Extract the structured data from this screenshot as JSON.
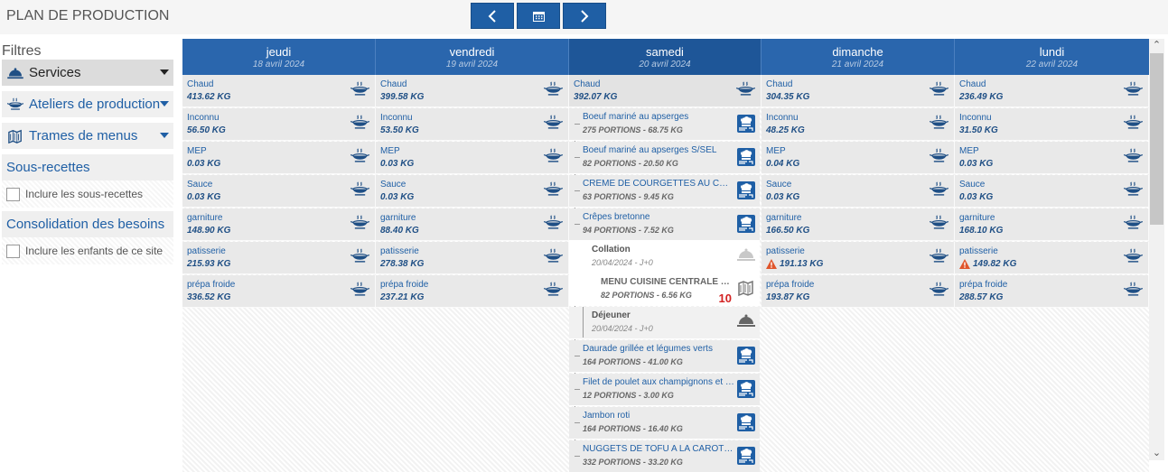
{
  "app": {
    "title": "PLAN DE PRODUCTION"
  },
  "nav": {
    "prev_icon": "chevron-left-icon",
    "calendar_icon": "calendar-icon",
    "next_icon": "chevron-right-icon"
  },
  "sidebar": {
    "title": "Filtres",
    "filters": [
      {
        "label": "Services",
        "icon": "bell-icon"
      },
      {
        "label": "Ateliers de production",
        "icon": "pot-icon"
      },
      {
        "label": "Trames de menus",
        "icon": "menu-grid-icon"
      }
    ],
    "subrecipes": {
      "title": "Sous-recettes",
      "checkbox_label": "Inclure les sous-recettes",
      "checked": false
    },
    "consolidation": {
      "title": "Consolidation des besoins",
      "checkbox_label": "Inclure les enfants de ce site",
      "checked": false
    }
  },
  "colors": {
    "header": "#2a66ad",
    "header_selected": "#1e5698",
    "link": "#1f5fa5",
    "warning": "#e0552b",
    "count": "#d32222"
  },
  "days": [
    {
      "name": "jeudi",
      "date": "18 avril 2024",
      "rows": [
        {
          "name": "Chaud",
          "value": "413.62 KG"
        },
        {
          "name": "Inconnu",
          "value": "56.50 KG"
        },
        {
          "name": "MEP",
          "value": "0.03 KG"
        },
        {
          "name": "Sauce",
          "value": "0.03 KG"
        },
        {
          "name": "garniture",
          "value": "148.90 KG"
        },
        {
          "name": "patisserie",
          "value": "215.93 KG"
        },
        {
          "name": "prépa froide",
          "value": "336.52 KG"
        }
      ]
    },
    {
      "name": "vendredi",
      "date": "19 avril 2024",
      "rows": [
        {
          "name": "Chaud",
          "value": "399.58 KG"
        },
        {
          "name": "Inconnu",
          "value": "53.50 KG"
        },
        {
          "name": "MEP",
          "value": "0.03 KG"
        },
        {
          "name": "Sauce",
          "value": "0.03 KG"
        },
        {
          "name": "garniture",
          "value": "88.40 KG"
        },
        {
          "name": "patisserie",
          "value": "278.38 KG"
        },
        {
          "name": "prépa froide",
          "value": "237.21 KG"
        }
      ]
    },
    {
      "name": "samedi",
      "date": "20 avril 2024",
      "rows": [
        {
          "name": "Chaud",
          "value": "392.07 KG"
        }
      ]
    },
    {
      "name": "dimanche",
      "date": "21 avril 2024",
      "rows": [
        {
          "name": "Chaud",
          "value": "304.35 KG"
        },
        {
          "name": "Inconnu",
          "value": "48.25 KG"
        },
        {
          "name": "MEP",
          "value": "0.04 KG"
        },
        {
          "name": "Sauce",
          "value": "0.03 KG"
        },
        {
          "name": "garniture",
          "value": "166.50 KG"
        },
        {
          "name": "patisserie",
          "value": "191.13 KG",
          "warning": true
        },
        {
          "name": "prépa froide",
          "value": "193.87 KG"
        }
      ]
    },
    {
      "name": "lundi",
      "date": "22 avril 2024",
      "rows": [
        {
          "name": "Chaud",
          "value": "236.49 KG"
        },
        {
          "name": "Inconnu",
          "value": "31.50 KG"
        },
        {
          "name": "MEP",
          "value": "0.03 KG"
        },
        {
          "name": "Sauce",
          "value": "0.03 KG"
        },
        {
          "name": "garniture",
          "value": "168.10 KG"
        },
        {
          "name": "patisserie",
          "value": "149.82 KG",
          "warning": true
        },
        {
          "name": "prépa froide",
          "value": "288.57 KG"
        }
      ]
    }
  ],
  "samedi_items": [
    {
      "name": "Boeuf mariné au apserges",
      "sub": "275 PORTIONS - 68.75 KG"
    },
    {
      "name": "Boeuf mariné au apserges S/SEL",
      "sub": "82 PORTIONS - 20.50 KG"
    },
    {
      "name": "CREME DE COURGETTES AU CHEVRE",
      "sub": "63 PORTIONS - 9.45 KG"
    },
    {
      "name": "Crêpes bretonne",
      "sub": "94 PORTIONS - 7.52 KG"
    }
  ],
  "collation": {
    "name": "Collation",
    "date": "20/04/2024 - J+0"
  },
  "menu": {
    "name": "MENU CUISINE CENTRALE MIDI",
    "sub": "82 PORTIONS - 6.56 KG",
    "count": "10"
  },
  "dejeuner": {
    "name": "Déjeuner",
    "date": "20/04/2024 - J+0"
  },
  "samedi_items2": [
    {
      "name": "Daurade grillée et légumes verts",
      "sub": "164 PORTIONS - 41.00 KG"
    },
    {
      "name": "Filet de poulet aux champignons et crème",
      "sub": "12 PORTIONS - 3.00 KG"
    },
    {
      "name": "Jambon roti",
      "sub": "164 PORTIONS - 16.40 KG"
    },
    {
      "name": "NUGGETS DE TOFU A LA CAROTTE",
      "sub": "332 PORTIONS - 33.20 KG"
    }
  ]
}
